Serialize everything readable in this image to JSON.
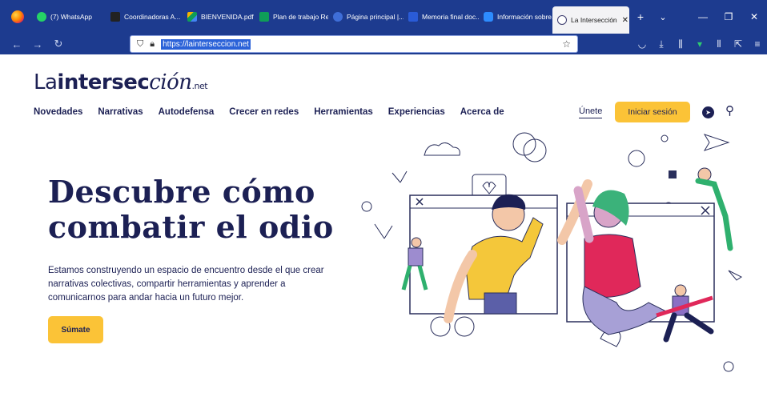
{
  "browser": {
    "tabs": [
      {
        "label": "(7) WhatsApp",
        "color": "#25d366"
      },
      {
        "label": "Coordinadoras A...",
        "color": "#222222"
      },
      {
        "label": "BIENVENIDA.pdf",
        "color": "#f4b400"
      },
      {
        "label": "Plan de trabajo Re...",
        "color": "#0f9d58"
      },
      {
        "label": "Página principal |...",
        "color": "#3f6ed8"
      },
      {
        "label": "Memoria final doc...",
        "color": "#2a5bd7"
      },
      {
        "label": "Información sobre...",
        "color": "#2d8cff"
      },
      {
        "label": "La Intersección",
        "color": "#3b3b6d"
      }
    ],
    "url": "https://lainterseccion.net"
  },
  "site": {
    "logo": {
      "part1": "La",
      "part2": "intersec",
      "part3": "ción",
      "part4": ".net"
    },
    "menu": [
      "Novedades",
      "Narrativas",
      "Autodefensa",
      "Crecer en redes",
      "Herramientas",
      "Experiencias",
      "Acerca de"
    ],
    "join_label": "Únete",
    "login_label": "Iniciar sesión",
    "hero": {
      "title_line1": "Descubre cómo",
      "title_line2": "combatir el odio",
      "text": "Estamos construyendo un espacio de encuentro desde el que crear narrativas colectivas, compartir herramientas y aprender a comunicarnos para andar hacia un futuro mejor.",
      "cta_label": "Súmate"
    }
  },
  "colors": {
    "brand_navy": "#1c2054",
    "accent_yellow": "#fbc337",
    "browser_blue": "#1d3b8f"
  }
}
